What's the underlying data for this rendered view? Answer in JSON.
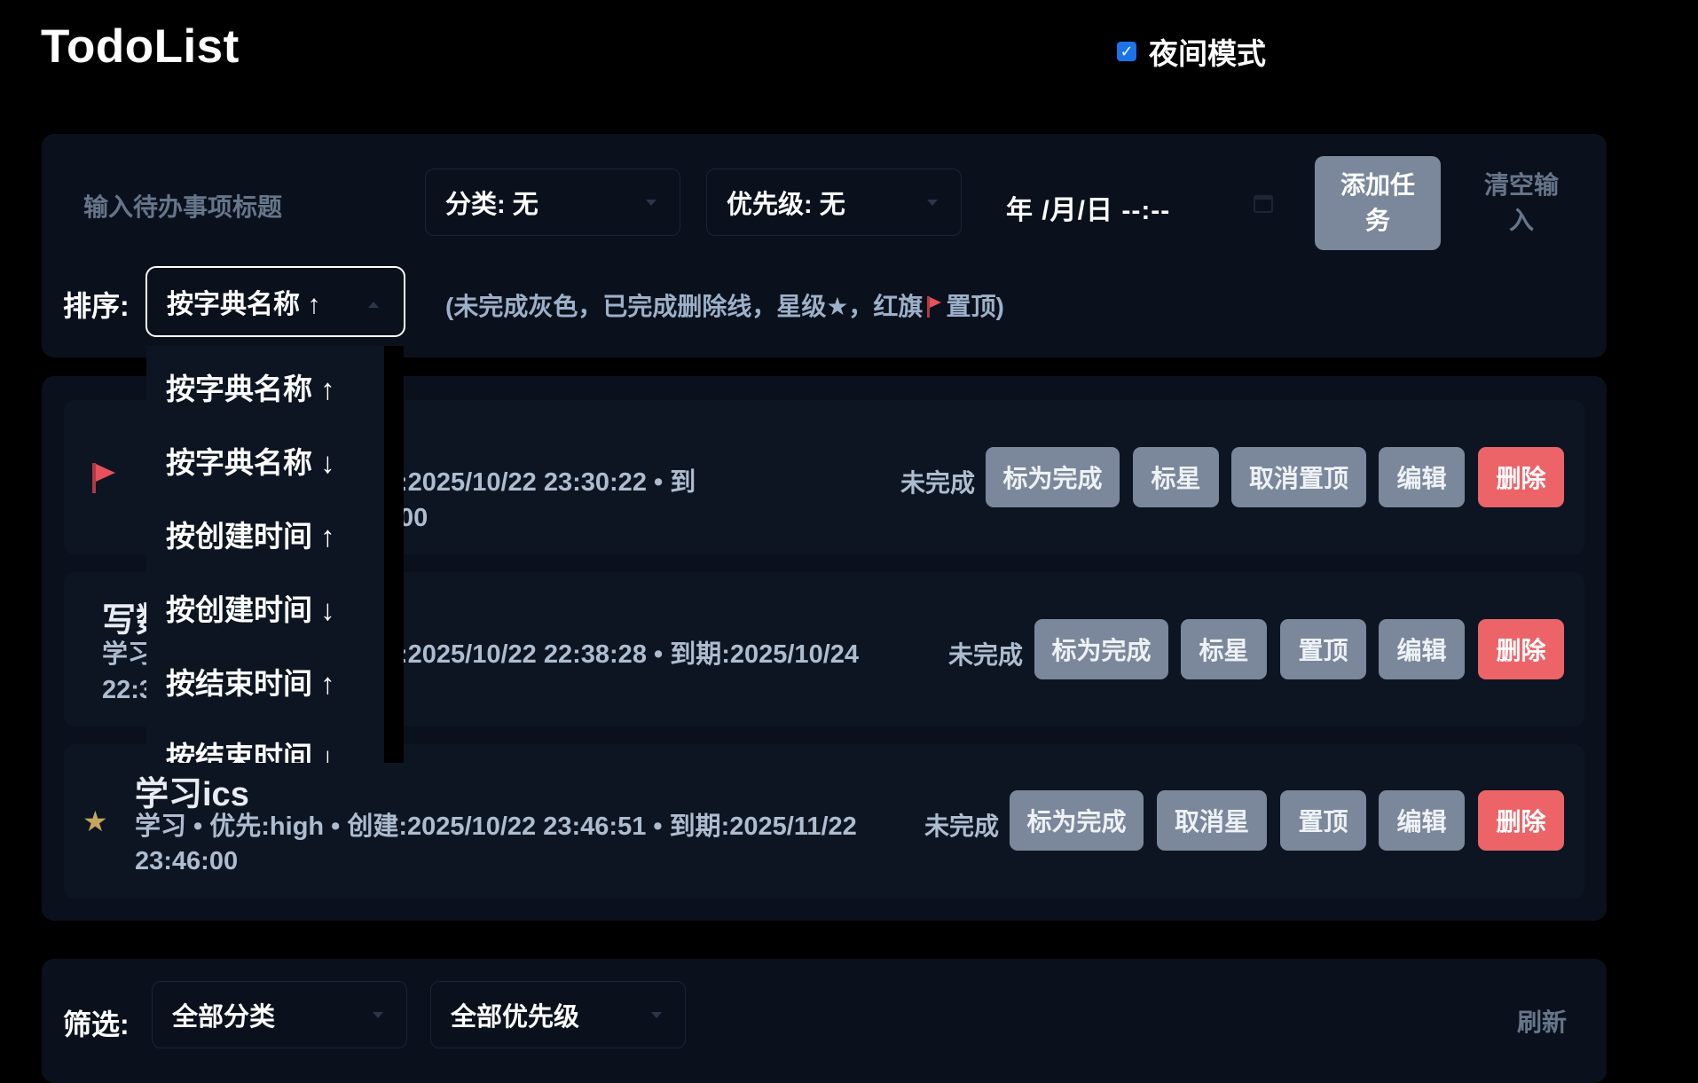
{
  "header": {
    "title": "TodoList",
    "night_mode_label": "夜间模式",
    "night_mode_checked": true
  },
  "add_form": {
    "title_placeholder": "输入待办事项标题",
    "category_select": "分类: 无",
    "priority_select": "优先级: 无",
    "date_placeholder": "年 /月/日 --:--",
    "add_button": "添加任务",
    "clear_button": "清空输入"
  },
  "sort": {
    "label": "排序:",
    "selected": "按字典名称 ↑",
    "hint_prefix": "(未完成灰色，已完成删除线，星级★，红旗",
    "hint_suffix": "置顶)",
    "options": [
      "按字典名称 ↑",
      "按字典名称 ↓",
      "按创建时间 ↑",
      "按创建时间 ↓",
      "按结束时间 ↑",
      "按结束时间 ↓"
    ]
  },
  "tasks": [
    {
      "marker": "flag-icon",
      "title": "",
      "meta_line1": ":2025/10/22 23:30:22 • 到",
      "meta_line2": "00",
      "status": "未完成",
      "buttons": [
        "标为完成",
        "标星",
        "取消置顶",
        "编辑",
        "删除"
      ]
    },
    {
      "marker": "none",
      "title": "写数",
      "meta_line1_prefix": "学习",
      "meta_line1": ":2025/10/22 22:38:28 • 到期:2025/10/24",
      "meta_line2": "22:3",
      "status": "未完成",
      "buttons": [
        "标为完成",
        "标星",
        "置顶",
        "编辑",
        "删除"
      ]
    },
    {
      "marker": "star-icon",
      "title": "学习ics",
      "meta_line1": "学习 • 优先:high • 创建:2025/10/22 23:46:51 • 到期:2025/11/22",
      "meta_line2": "23:46:00",
      "status": "未完成",
      "buttons": [
        "标为完成",
        "取消星",
        "置顶",
        "编辑",
        "删除"
      ]
    }
  ],
  "filter": {
    "label": "筛选:",
    "category": "全部分类",
    "priority": "全部优先级",
    "refresh": "刷新"
  },
  "colors": {
    "accent_red": "#ec6468",
    "button_gray": "#7b889b",
    "panel": "#0a111d",
    "star": "#c6a560",
    "flag": "#e8505b"
  }
}
